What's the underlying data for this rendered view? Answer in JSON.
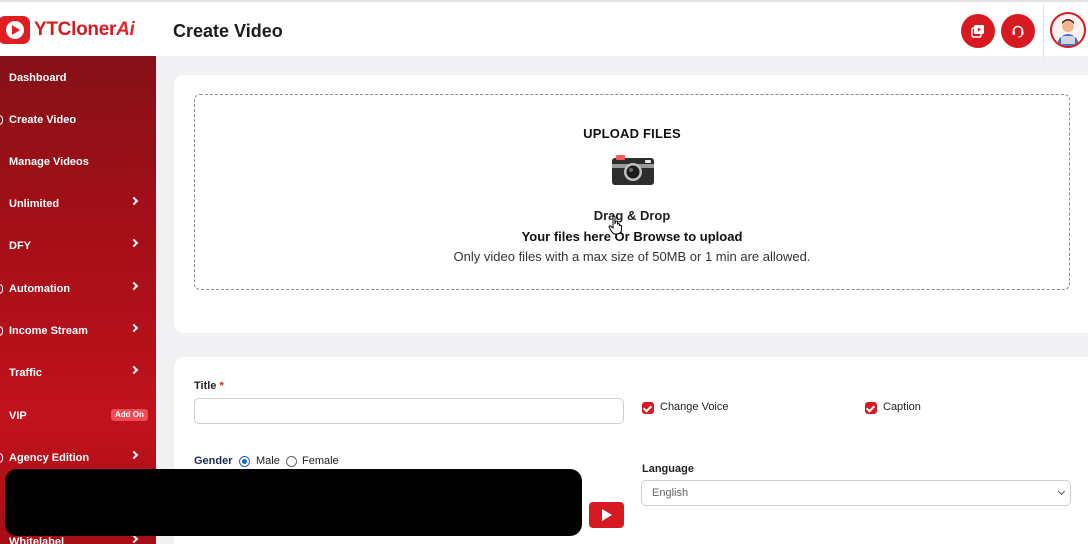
{
  "app": {
    "logo_main": "YTCloner",
    "logo_accent": "Ai",
    "page_title": "Create Video"
  },
  "sidebar": {
    "items": [
      {
        "label": "Dashboard",
        "chevron": false
      },
      {
        "label": "Create Video",
        "chevron": false
      },
      {
        "label": "Manage Videos",
        "chevron": false
      },
      {
        "label": "Unlimited",
        "chevron": true
      },
      {
        "label": "DFY",
        "chevron": true
      },
      {
        "label": "Automation",
        "chevron": true
      },
      {
        "label": "Income Stream",
        "chevron": true
      },
      {
        "label": "Traffic",
        "chevron": true
      },
      {
        "label": "VIP",
        "chevron": false,
        "badge": "Add On"
      },
      {
        "label": "Agency Edition",
        "chevron": true
      },
      {
        "label": "Whitelabel",
        "chevron": true
      }
    ]
  },
  "upload": {
    "title": "UPLOAD FILES",
    "line1": "Drag & Drop",
    "line2": "Your files here Or Browse to upload",
    "line3": "Only video files with a max size of 50MB or 1 min are allowed."
  },
  "form": {
    "title_label": "Title",
    "required_mark": "*",
    "title_value": "",
    "change_voice_label": "Change Voice",
    "change_voice_checked": true,
    "caption_label": "Caption",
    "caption_checked": true,
    "gender_label": "Gender",
    "gender_options": [
      "Male",
      "Female"
    ],
    "gender_selected": "Male",
    "language_label": "Language",
    "language_value": "English"
  },
  "icons": {
    "header_button_1": "video-library-icon",
    "header_button_2": "headset-support-icon",
    "upload": "camera-icon",
    "play": "play-icon"
  },
  "colors": {
    "brand_red": "#d71a21",
    "sidebar_dark": "#861018",
    "sidebar_light": "#c1121c",
    "badge": "#f04a55"
  }
}
